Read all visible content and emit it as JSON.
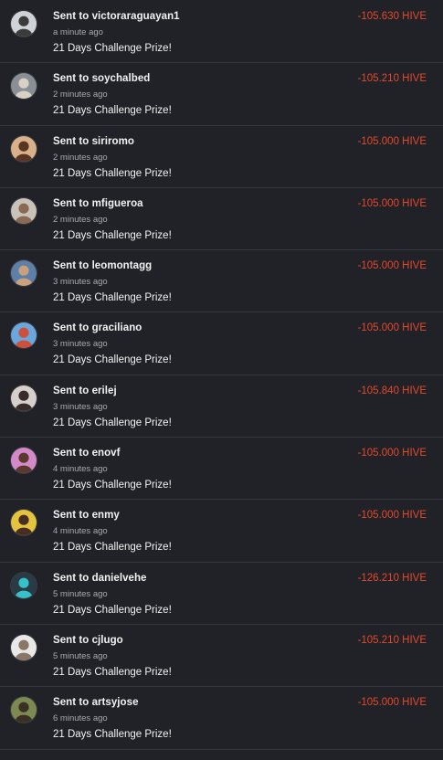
{
  "colors": {
    "background": "#212227",
    "divider": "#34363c",
    "amount": "#e3492d",
    "text": "#f2f2f2",
    "muted": "#a9aaae"
  },
  "transactions": [
    {
      "title": "Sent to victoraraguayan1",
      "time": "a minute ago",
      "memo": "21 Days Challenge Prize!",
      "amount": "-105.630 HIVE",
      "avatar_bg": "#cfd3d8",
      "avatar_fg": "#3b3b3b"
    },
    {
      "title": "Sent to soychalbed",
      "time": "2 minutes ago",
      "memo": "21 Days Challenge Prize!",
      "amount": "-105.210 HIVE",
      "avatar_bg": "#8a8f96",
      "avatar_fg": "#d9d2c4"
    },
    {
      "title": "Sent to siriromo",
      "time": "2 minutes ago",
      "memo": "21 Days Challenge Prize!",
      "amount": "-105.000 HIVE",
      "avatar_bg": "#d8b08a",
      "avatar_fg": "#5a3524"
    },
    {
      "title": "Sent to mfigueroa",
      "time": "2 minutes ago",
      "memo": "21 Days Challenge Prize!",
      "amount": "-105.000 HIVE",
      "avatar_bg": "#c9c2b8",
      "avatar_fg": "#8a6a52"
    },
    {
      "title": "Sent to leomontagg",
      "time": "3 minutes ago",
      "memo": "21 Days Challenge Prize!",
      "amount": "-105.000 HIVE",
      "avatar_bg": "#5d7fa8",
      "avatar_fg": "#caa07e"
    },
    {
      "title": "Sent to graciliano",
      "time": "3 minutes ago",
      "memo": "21 Days Challenge Prize!",
      "amount": "-105.000 HIVE",
      "avatar_bg": "#6aa7dd",
      "avatar_fg": "#d04f3b"
    },
    {
      "title": "Sent to erilej",
      "time": "3 minutes ago",
      "memo": "21 Days Challenge Prize!",
      "amount": "-105.840 HIVE",
      "avatar_bg": "#d7cfcc",
      "avatar_fg": "#3a2b2b"
    },
    {
      "title": "Sent to enovf",
      "time": "4 minutes ago",
      "memo": "21 Days Challenge Prize!",
      "amount": "-105.000 HIVE",
      "avatar_bg": "#d48ac9",
      "avatar_fg": "#5b3a2e"
    },
    {
      "title": "Sent to enmy",
      "time": "4 minutes ago",
      "memo": "21 Days Challenge Prize!",
      "amount": "-105.000 HIVE",
      "avatar_bg": "#e4c43e",
      "avatar_fg": "#4a2d22"
    },
    {
      "title": "Sent to danielvehe",
      "time": "5 minutes ago",
      "memo": "21 Days Challenge Prize!",
      "amount": "-126.210 HIVE",
      "avatar_bg": "#2a3b45",
      "avatar_fg": "#36c0c9"
    },
    {
      "title": "Sent to cjlugo",
      "time": "5 minutes ago",
      "memo": "21 Days Challenge Prize!",
      "amount": "-105.210 HIVE",
      "avatar_bg": "#e8e8e8",
      "avatar_fg": "#8b7766"
    },
    {
      "title": "Sent to artsyjose",
      "time": "6 minutes ago",
      "memo": "21 Days Challenge Prize!",
      "amount": "-105.000 HIVE",
      "avatar_bg": "#7c8a52",
      "avatar_fg": "#3a3024"
    }
  ]
}
